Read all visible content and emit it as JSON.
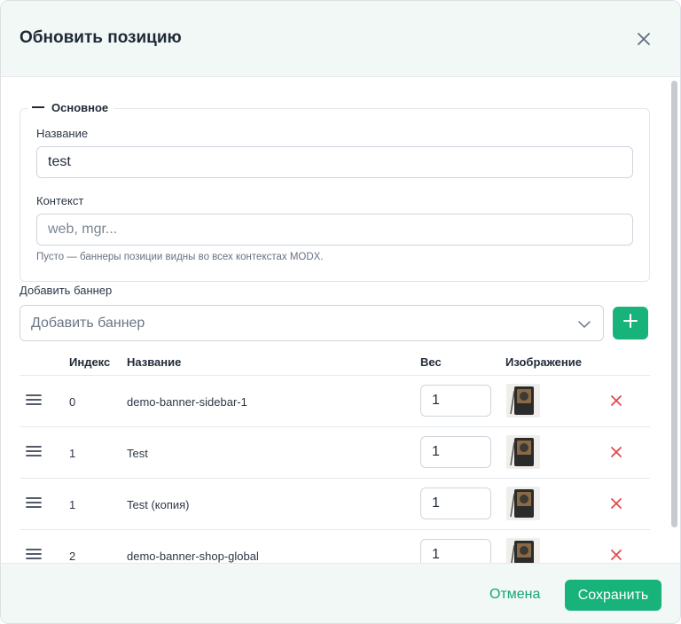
{
  "dialog": {
    "title": "Обновить позицию",
    "close_icon": "close-icon"
  },
  "group": {
    "legend": "Основное",
    "name_label": "Название",
    "name_value": "test",
    "context_label": "Контекст",
    "context_placeholder": "web, mgr...",
    "context_hint": "Пусто — баннеры позиции видны во всех контекстах MODX."
  },
  "add_banner": {
    "label": "Добавить баннер",
    "placeholder": "Добавить баннер",
    "add_icon": "plus-icon"
  },
  "table": {
    "headers": {
      "index": "Индекс",
      "name": "Название",
      "weight": "Вес",
      "image": "Изображение"
    },
    "rows": [
      {
        "index": "0",
        "name": "demo-banner-sidebar-1",
        "weight": "1"
      },
      {
        "index": "1",
        "name": "Test",
        "weight": "1"
      },
      {
        "index": "1",
        "name": "Test (копия)",
        "weight": "1"
      },
      {
        "index": "2",
        "name": "demo-banner-shop-global",
        "weight": "1"
      }
    ]
  },
  "footer": {
    "cancel_label": "Отмена",
    "save_label": "Сохранить"
  },
  "colors": {
    "accent": "#18b27b",
    "delete": "#e5484d",
    "header_bg": "#f2f8f6"
  }
}
